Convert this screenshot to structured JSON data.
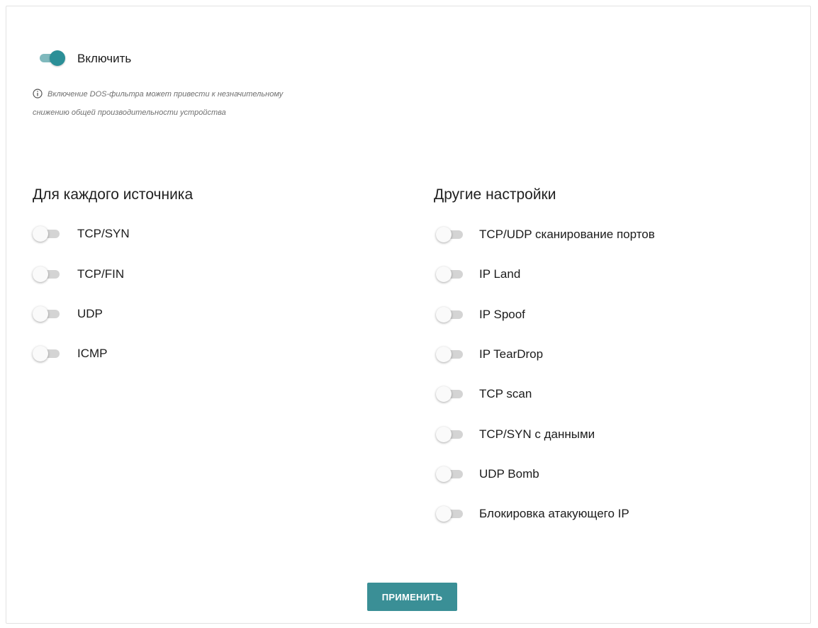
{
  "enable": {
    "label": "Включить",
    "on": true
  },
  "note": {
    "line1": "Включение DOS-фильтра может привести к незначительному",
    "line2": "снижению общей производительности устройства"
  },
  "per_source": {
    "title": "Для каждого источника",
    "items": [
      {
        "label": "TCP/SYN",
        "on": false
      },
      {
        "label": "TCP/FIN",
        "on": false
      },
      {
        "label": "UDP",
        "on": false
      },
      {
        "label": "ICMP",
        "on": false
      }
    ]
  },
  "other": {
    "title": "Другие настройки",
    "items": [
      {
        "label": "TCP/UDP сканирование портов",
        "on": false
      },
      {
        "label": "IP Land",
        "on": false
      },
      {
        "label": "IP Spoof",
        "on": false
      },
      {
        "label": "IP TearDrop",
        "on": false
      },
      {
        "label": "TCP scan",
        "on": false
      },
      {
        "label": "TCP/SYN с данными",
        "on": false
      },
      {
        "label": "UDP Bomb",
        "on": false
      },
      {
        "label": "Блокировка атакующего IP",
        "on": false
      }
    ]
  },
  "apply_label": "ПРИМЕНИТЬ",
  "colors": {
    "accent": "#3a8f96",
    "toggle_on_knob": "#2b8f97",
    "toggle_on_track": "#7fb9bd",
    "toggle_off_track": "#d4d4d4"
  }
}
